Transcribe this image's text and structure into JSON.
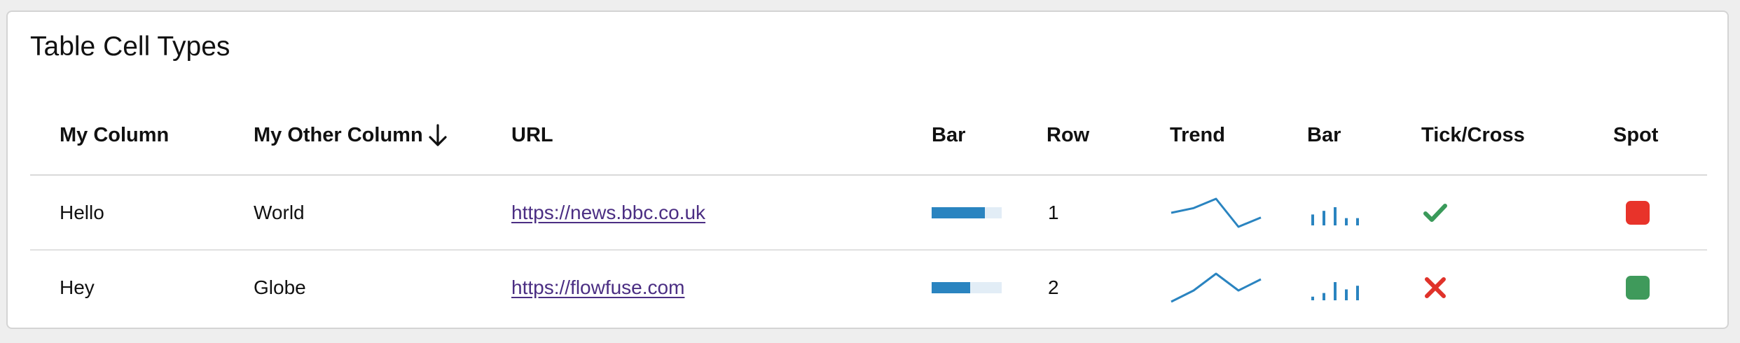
{
  "card": {
    "title": "Table Cell Types"
  },
  "table": {
    "headers": [
      "My Column",
      "My Other Column",
      "URL",
      "Bar",
      "Row",
      "Trend",
      "Bar",
      "Tick/Cross",
      "Spot"
    ],
    "sort": {
      "column": "My Other Column",
      "direction": "descending",
      "icon": "arrow-down-icon"
    },
    "rows": [
      {
        "my_column": "Hello",
        "my_other_column": "World",
        "url": "https://news.bbc.co.uk",
        "progress": 0.76,
        "row": "1",
        "trend": [
          4,
          5,
          7,
          1,
          3
        ],
        "bars": [
          3,
          4,
          5,
          2,
          2
        ],
        "tick": true,
        "spot_color": "#e8332a"
      },
      {
        "my_column": "Hey",
        "my_other_column": "Globe",
        "url": "https://flowfuse.com",
        "progress": 0.55,
        "row": "2",
        "trend": [
          1,
          3,
          6,
          3,
          5
        ],
        "bars": [
          1,
          2,
          5,
          3,
          4
        ],
        "tick": false,
        "spot_color": "#3f9a5b"
      }
    ]
  },
  "colors": {
    "accent": "#2a84c0",
    "accent_light": "#e2edf6",
    "tick": "#3a9a5a",
    "cross": "#e0322a",
    "link": "#4b2e83"
  }
}
